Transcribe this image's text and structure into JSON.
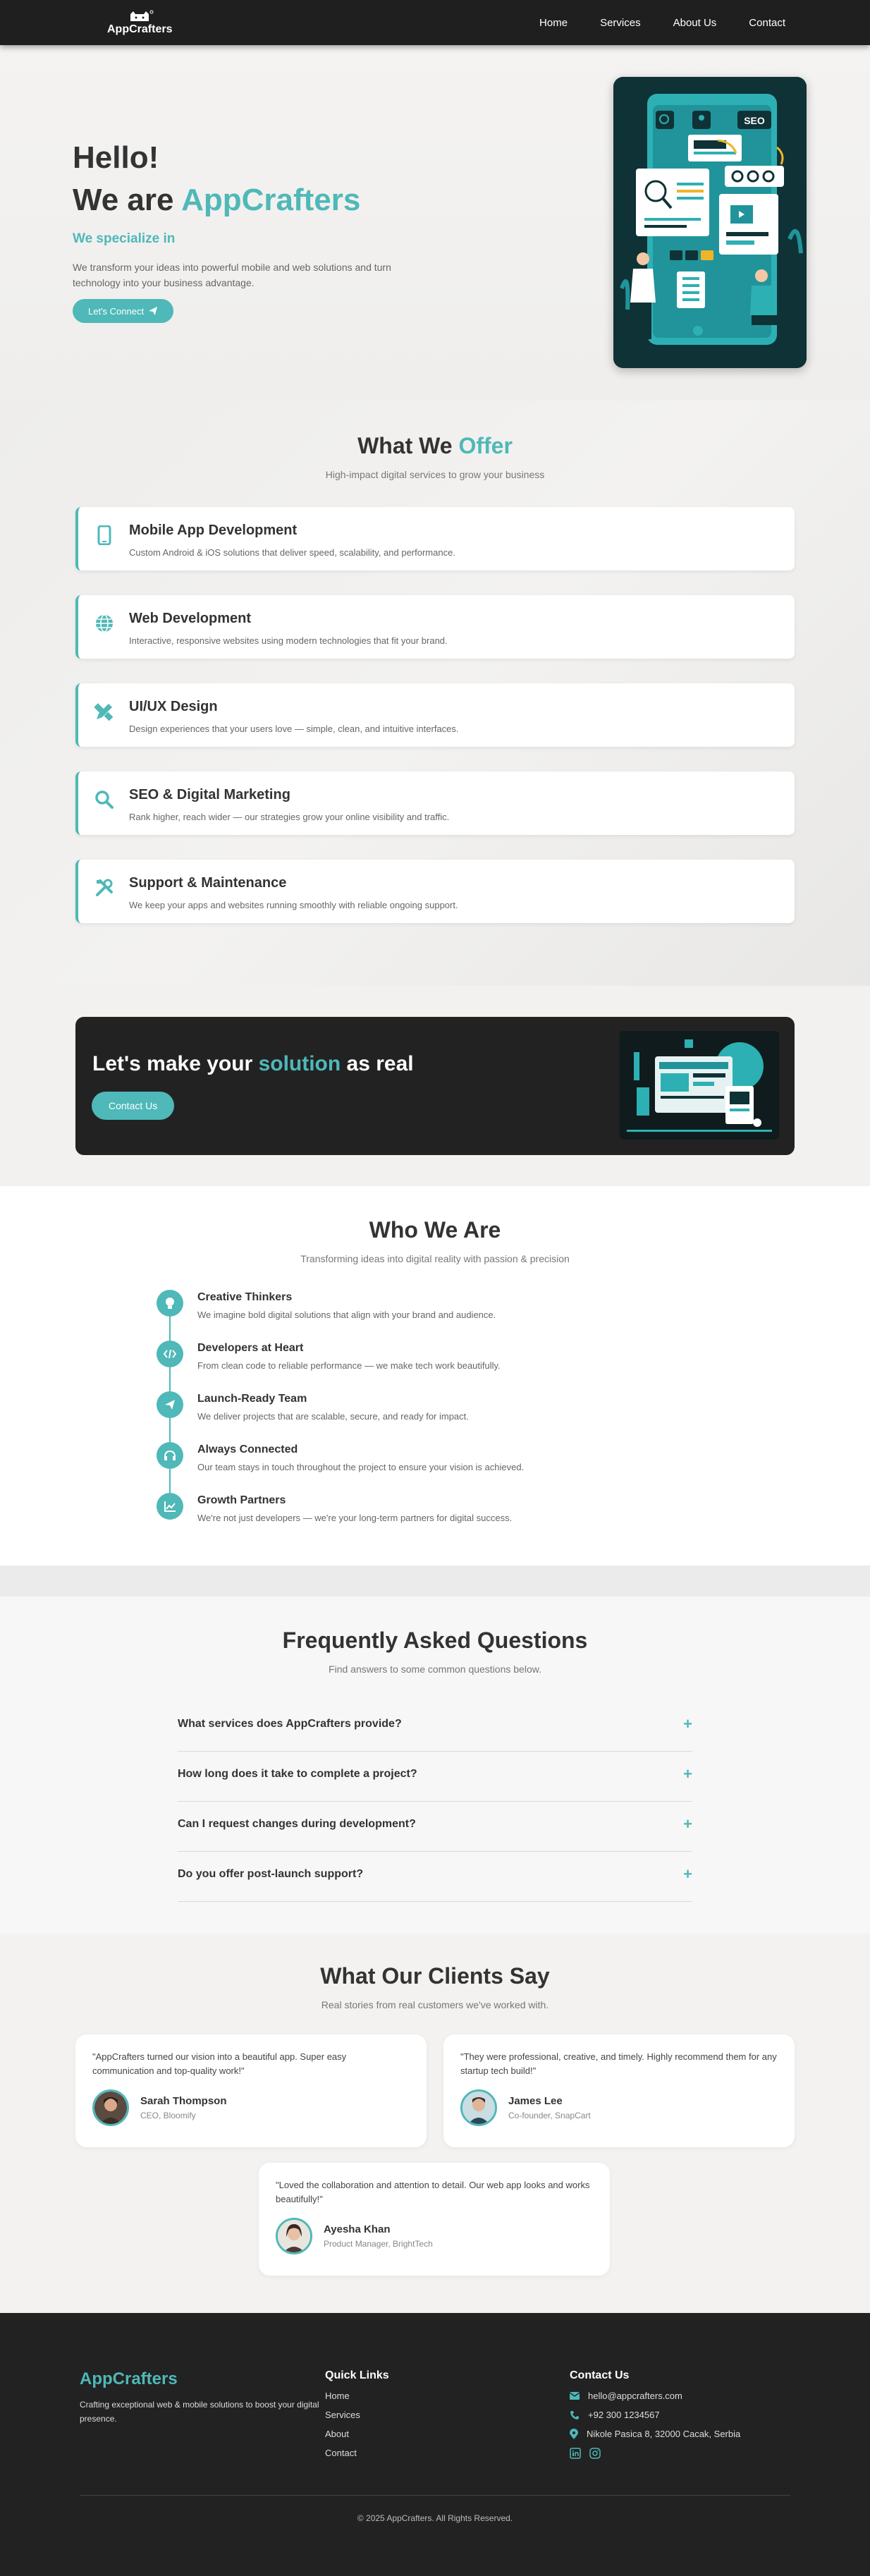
{
  "brand": {
    "name": "AppCrafters",
    "accent": "#4fb8b8",
    "dark": "#222222"
  },
  "nav": {
    "links": [
      "Home",
      "Services",
      "About Us",
      "Contact"
    ]
  },
  "hero": {
    "line1": "Hello!",
    "line2_prefix": "We are ",
    "line2_accent": "AppCrafters",
    "subtitle": "We specialize in",
    "description": "We transform your ideas into powerful mobile and web solutions and turn technology into your business advantage.",
    "cta_label": "Let's Connect",
    "art_badge": "SEO"
  },
  "services": {
    "title_prefix": "What We ",
    "title_accent": "Offer",
    "subtitle": "High-impact digital services to grow your business",
    "items": [
      {
        "icon": "mobile-icon",
        "title": "Mobile App Development",
        "description": "Custom Android & iOS solutions that deliver speed, scalability, and performance."
      },
      {
        "icon": "globe-icon",
        "title": "Web Development",
        "description": "Interactive, responsive websites using modern technologies that fit your brand."
      },
      {
        "icon": "design-tools-icon",
        "title": "UI/UX Design",
        "description": "Design experiences that your users love — simple, clean, and intuitive interfaces."
      },
      {
        "icon": "search-icon",
        "title": "SEO & Digital Marketing",
        "description": "Rank higher, reach wider — our strategies grow your online visibility and traffic."
      },
      {
        "icon": "tools-icon",
        "title": "Support & Maintenance",
        "description": "We keep your apps and websites running smoothly with reliable ongoing support."
      }
    ]
  },
  "cta": {
    "title_prefix": "Let's make your ",
    "title_accent": "solution",
    "title_suffix": " as real",
    "button": "Contact Us"
  },
  "who": {
    "title": "Who We Are",
    "subtitle": "Transforming ideas into digital reality with passion & precision",
    "items": [
      {
        "icon": "lightbulb-icon",
        "title": "Creative Thinkers",
        "description": "We imagine bold digital solutions that align with your brand and audience."
      },
      {
        "icon": "code-icon",
        "title": "Developers at Heart",
        "description": "From clean code to reliable performance — we make tech work beautifully."
      },
      {
        "icon": "paper-plane-icon",
        "title": "Launch-Ready Team",
        "description": "We deliver projects that are scalable, secure, and ready for impact."
      },
      {
        "icon": "headset-icon",
        "title": "Always Connected",
        "description": "Our team stays in touch throughout the project to ensure your vision is achieved."
      },
      {
        "icon": "chart-line-icon",
        "title": "Growth Partners",
        "description": "We're not just developers — we're your long-term partners for digital success."
      }
    ]
  },
  "faq": {
    "title": "Frequently Asked Questions",
    "subtitle": "Find answers to some common questions below.",
    "items": [
      "What services does AppCrafters provide?",
      "How long does it take to complete a project?",
      "Can I request changes during development?",
      "Do you offer post-launch support?"
    ],
    "toggle": "+"
  },
  "testimonials": {
    "title": "What Our Clients Say",
    "subtitle": "Real stories from real customers we've worked with.",
    "items": [
      {
        "quote": "\"AppCrafters turned our vision into a beautiful app. Super easy communication and top-quality work!\"",
        "name": "Sarah Thompson",
        "role": "CEO, Bloomify"
      },
      {
        "quote": "\"They were professional, creative, and timely. Highly recommend them for any startup tech build!\"",
        "name": "James Lee",
        "role": "Co-founder, SnapCart"
      },
      {
        "quote": "\"Loved the collaboration and attention to detail. Our web app looks and works beautifully!\"",
        "name": "Ayesha Khan",
        "role": "Product Manager, BrightTech"
      }
    ]
  },
  "footer": {
    "brand": "AppCrafters",
    "tagline": "Crafting exceptional web & mobile solutions to boost your digital presence.",
    "quick_links_title": "Quick Links",
    "quick_links": [
      "Home",
      "Services",
      "About",
      "Contact"
    ],
    "contact_title": "Contact Us",
    "email": "hello@appcrafters.com",
    "phone": "+92 300 1234567",
    "address": "Nikole Pasica 8, 32000 Cacak, Serbia",
    "copyright": "© 2025 AppCrafters. All Rights Reserved."
  }
}
